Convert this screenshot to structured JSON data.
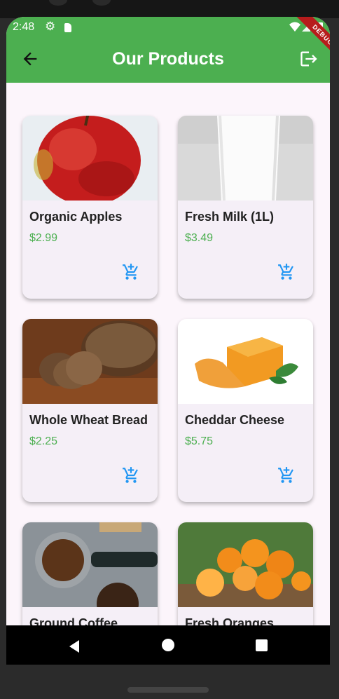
{
  "status_bar": {
    "time": "2:48",
    "icons": [
      "gear-icon",
      "sim-card-icon",
      "wifi-icon",
      "signal-icon",
      "battery-icon"
    ]
  },
  "app_bar": {
    "title": "Our Products",
    "back_icon": "arrow-back-icon",
    "logout_icon": "logout-icon",
    "color": "#4caf50"
  },
  "debug_banner": "DEBUG",
  "products": [
    {
      "name": "Organic Apples",
      "price": "$2.99",
      "image": "apple-image"
    },
    {
      "name": "Fresh Milk (1L)",
      "price": "$3.49",
      "image": "milk-image"
    },
    {
      "name": "Whole Wheat Bread",
      "price": "$2.25",
      "image": "bread-image"
    },
    {
      "name": "Cheddar Cheese",
      "price": "$5.75",
      "image": "cheese-image"
    },
    {
      "name": "Ground Coffee",
      "price": "",
      "image": "coffee-image"
    },
    {
      "name": "Fresh Oranges",
      "price": "",
      "image": "oranges-image"
    }
  ],
  "colors": {
    "primary": "#4caf50",
    "price": "#4caf50",
    "cart_icon": "#2196f3",
    "card_background": "#f5eff7",
    "page_background": "#fcf5fb"
  },
  "nav_bar": {
    "icons": [
      "nav-back-icon",
      "nav-home-icon",
      "nav-recent-icon"
    ]
  }
}
